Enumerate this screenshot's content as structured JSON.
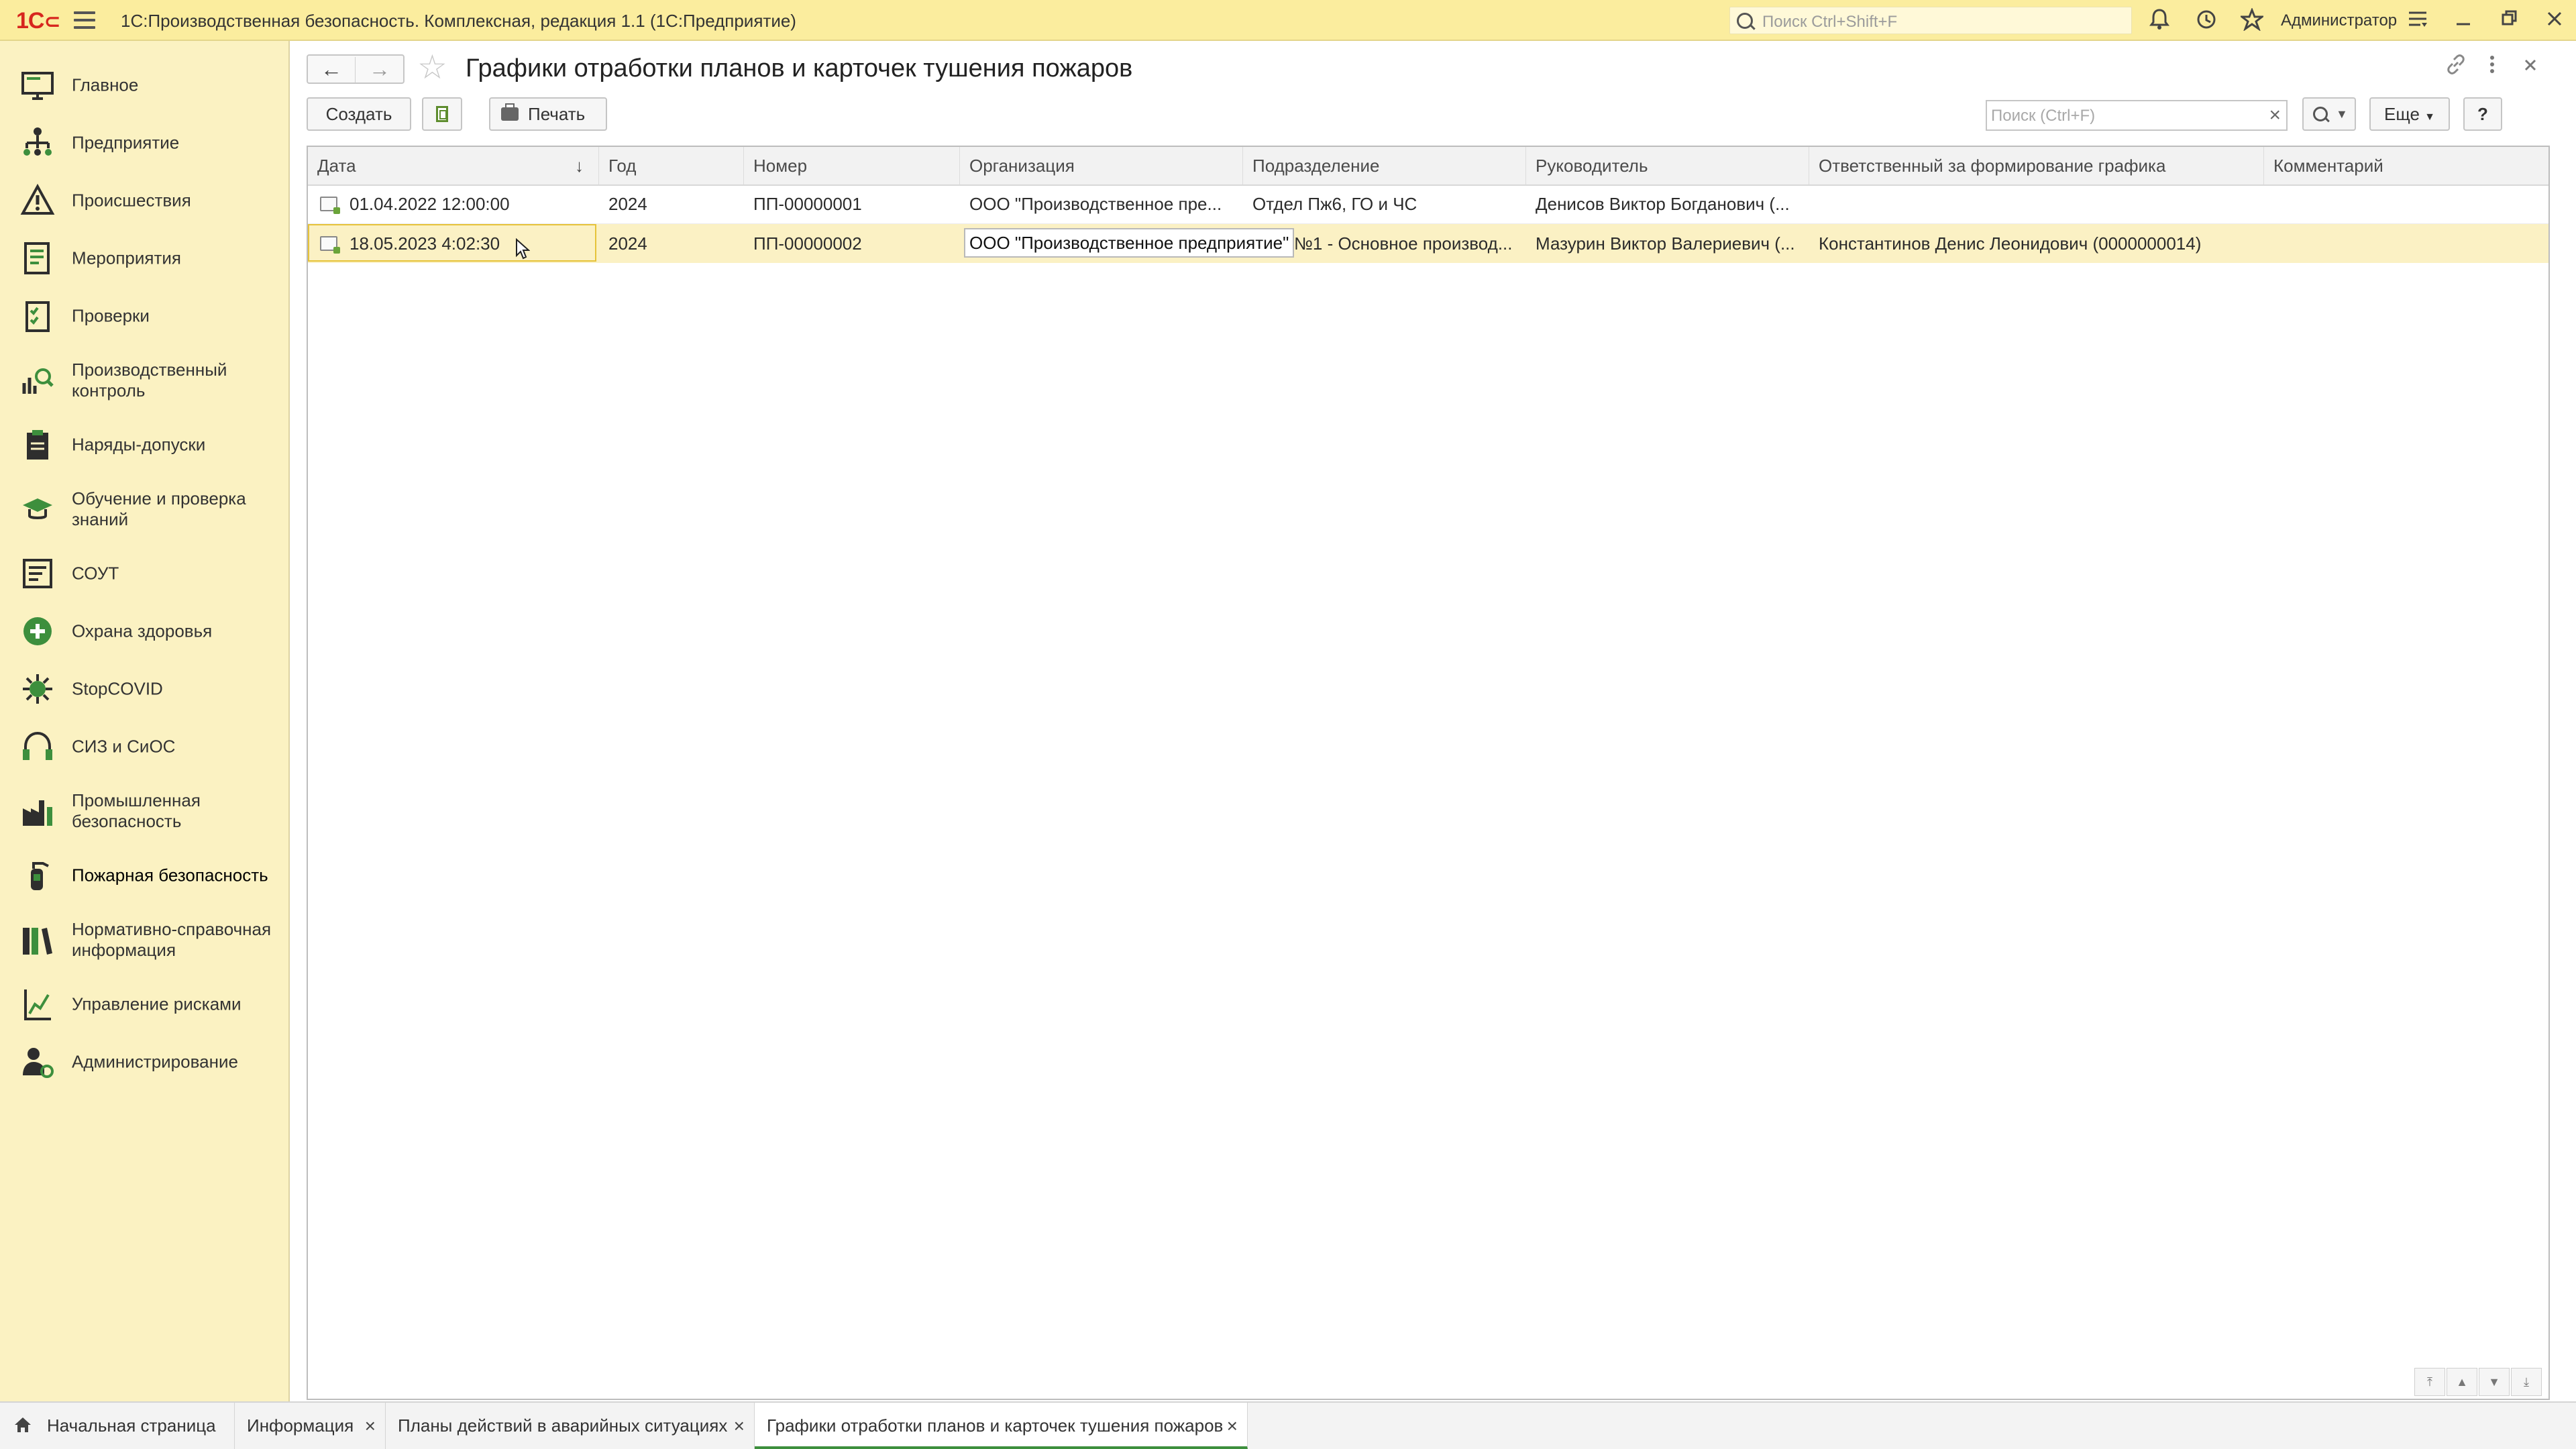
{
  "app": {
    "logo": "1С",
    "title": "1С:Производственная безопасность. Комплексная, редакция 1.1  (1С:Предприятие)",
    "search_placeholder": "Поиск Ctrl+Shift+F",
    "user": "Администратор"
  },
  "sidebar": {
    "items": [
      {
        "label": "Главное",
        "icon": "monitor-icon"
      },
      {
        "label": "Предприятие",
        "icon": "org-structure-icon"
      },
      {
        "label": "Происшествия",
        "icon": "warning-icon"
      },
      {
        "label": "Мероприятия",
        "icon": "list-icon"
      },
      {
        "label": "Проверки",
        "icon": "checklist-icon"
      },
      {
        "label": "Производственный\nконтроль",
        "icon": "chart-magnifier-icon"
      },
      {
        "label": "Наряды-допуски",
        "icon": "clipboard-icon"
      },
      {
        "label": "Обучение и проверка\nзнаний",
        "icon": "education-icon"
      },
      {
        "label": "СОУТ",
        "icon": "document-list-icon"
      },
      {
        "label": "Охрана здоровья",
        "icon": "medical-cross-icon"
      },
      {
        "label": "StopCOVID",
        "icon": "virus-icon"
      },
      {
        "label": "СИЗ и СиОС",
        "icon": "headphones-icon"
      },
      {
        "label": "Промышленная\nбезопасность",
        "icon": "factory-icon"
      },
      {
        "label": "Пожарная безопасность",
        "icon": "fire-extinguisher-icon"
      },
      {
        "label": "Нормативно-справочная\nинформация",
        "icon": "books-icon"
      },
      {
        "label": "Управление рисками",
        "icon": "risk-icon"
      },
      {
        "label": "Администрирование",
        "icon": "admin-user-icon"
      }
    ]
  },
  "form": {
    "title": "Графики отработки планов и карточек тушения пожаров",
    "buttons": {
      "create": "Создать",
      "print": "Печать",
      "more": "Еще",
      "help": "?"
    },
    "search_placeholder": "Поиск (Ctrl+F)",
    "search_clear": "×"
  },
  "table": {
    "columns": [
      "Дата",
      "Год",
      "Номер",
      "Организация",
      "Подразделение",
      "Руководитель",
      "Ответственный за формирование графика",
      "Комментарий"
    ],
    "sort_indicator": "↓",
    "rows": [
      {
        "date": "01.04.2022 12:00:00",
        "year": "2024",
        "number": "ПП-00000001",
        "org": "ООО \"Производственное пре...",
        "dept": "Отдел Пж6, ГО и ЧС",
        "head": "Денисов Виктор Богданович (...",
        "responsible": "",
        "comment": ""
      },
      {
        "date": "18.05.2023 4:02:30",
        "year": "2024",
        "number": "ПП-00000002",
        "org": "ООО \"Производственное предприятие\"",
        "dept": "№1 - Основное производ...",
        "head": "Мазурин Виктор Валериевич (...",
        "responsible": "Константинов Денис Леонидович (0000000014)",
        "comment": ""
      }
    ]
  },
  "tabs": [
    {
      "label": "Начальная страница",
      "closable": false
    },
    {
      "label": "Информация",
      "closable": true
    },
    {
      "label": "Планы действий в аварийных ситуациях",
      "closable": true
    },
    {
      "label": "Графики отработки планов и карточек тушения пожаров",
      "closable": true,
      "active": true
    }
  ],
  "colors": {
    "titlebar": "#fbed9e",
    "sidebar": "#fbf2c2",
    "selected_row": "#fbf1c4",
    "accent_green": "#3d8f3d",
    "logo_red": "#d7261e"
  }
}
